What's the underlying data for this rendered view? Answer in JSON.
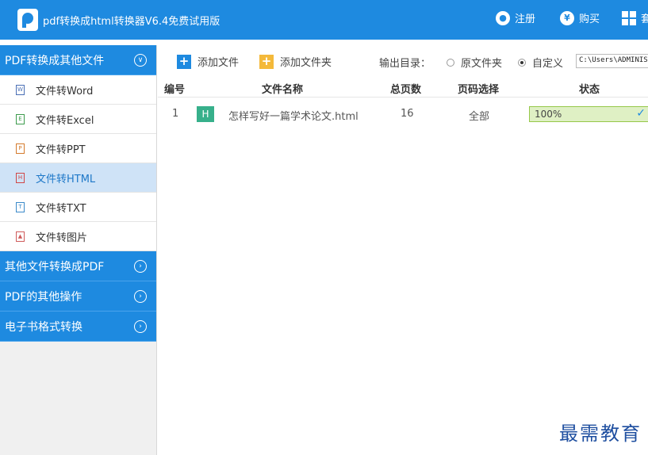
{
  "app": {
    "title": "pdf转换成html转换器V6.4免费试用版",
    "register_label": "注册",
    "buy_label": "购买",
    "more_label": "套",
    "accent_color": "#1e8ae0"
  },
  "sidebar": {
    "groups": [
      {
        "label": "PDF转换成其他文件",
        "expanded": true,
        "items": [
          {
            "label": "文件转Word",
            "icon": "word-file-icon",
            "icon_glyph": "W"
          },
          {
            "label": "文件转Excel",
            "icon": "excel-file-icon",
            "icon_glyph": "E"
          },
          {
            "label": "文件转PPT",
            "icon": "ppt-file-icon",
            "icon_glyph": "P"
          },
          {
            "label": "文件转HTML",
            "icon": "html-file-icon",
            "icon_glyph": "H",
            "active": true
          },
          {
            "label": "文件转TXT",
            "icon": "txt-file-icon",
            "icon_glyph": "T"
          },
          {
            "label": "文件转图片",
            "icon": "image-file-icon",
            "icon_glyph": "▲"
          }
        ]
      },
      {
        "label": "其他文件转换成PDF",
        "expanded": false
      },
      {
        "label": "PDF的其他操作",
        "expanded": false
      },
      {
        "label": "电子书格式转换",
        "expanded": false
      }
    ]
  },
  "toolbar": {
    "add_file_label": "添加文件",
    "add_folder_label": "添加文件夹",
    "output_dir_label": "输出目录：",
    "option_original_label": "原文件夹",
    "option_custom_label": "自定义",
    "selected_option": "自定义",
    "output_path": "C:\\Users\\ADMINISTRATOR"
  },
  "table": {
    "columns": [
      "编号",
      "文件名称",
      "总页数",
      "页码选择",
      "状态"
    ],
    "rows": [
      {
        "index": "1",
        "type_badge": "H",
        "filename": "怎样写好一篇学术论文.html",
        "pages": "16",
        "page_selection": "全部",
        "status": "100%",
        "progress": 1.0
      }
    ]
  },
  "watermark": "最需教育"
}
